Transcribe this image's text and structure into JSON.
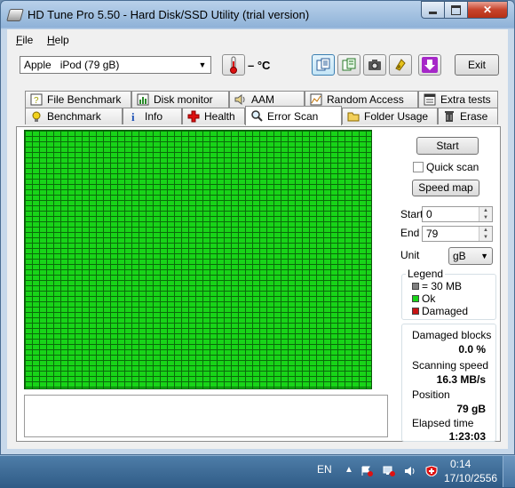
{
  "window": {
    "title": "HD Tune Pro 5.50 - Hard Disk/SSD Utility (trial version)"
  },
  "menu": {
    "items": [
      "File",
      "Help"
    ]
  },
  "toolbar": {
    "drive": "Apple   iPod (79 gB)",
    "temperature": "– °C",
    "exit_label": "Exit"
  },
  "tabs_top": [
    "File Benchmark",
    "Disk monitor",
    "AAM",
    "Random Access",
    "Extra tests"
  ],
  "tabs_bottom": [
    "Benchmark",
    "Info",
    "Health",
    "Error Scan",
    "Folder Usage",
    "Erase"
  ],
  "active_tab": "Error Scan",
  "controls": {
    "start_label": "Start",
    "quick_scan_label": "Quick scan",
    "speed_map_label": "Speed map",
    "start_field_label": "Start",
    "start_value": "0",
    "end_field_label": "End",
    "end_value": "79",
    "unit_label": "Unit",
    "unit_value": "gB"
  },
  "legend": {
    "title": "Legend",
    "items": [
      {
        "label": "= 30 MB",
        "color": "#7f7f7f"
      },
      {
        "label": "Ok",
        "color": "#19d419"
      },
      {
        "label": "Damaged",
        "color": "#c81414"
      }
    ]
  },
  "stats": {
    "damaged_blocks_label": "Damaged blocks",
    "damaged_blocks_value": "0.0 %",
    "scanning_speed_label": "Scanning speed",
    "scanning_speed_value": "16.3 MB/s",
    "position_label": "Position",
    "position_value": "79 gB",
    "elapsed_label": "Elapsed time",
    "elapsed_value": "1:23:03"
  },
  "taskbar": {
    "language": "EN",
    "time": "0:14",
    "date": "17/10/2556"
  },
  "colors": {
    "ok_green": "#19d419",
    "grid_line": "#0b6a0b",
    "accent": "#b53016"
  }
}
